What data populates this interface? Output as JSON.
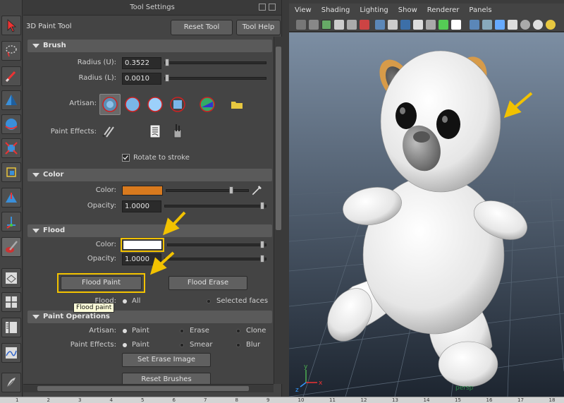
{
  "panel": {
    "title": "Tool Settings",
    "tool_name": "3D Paint Tool",
    "reset_tool": "Reset Tool",
    "tool_help": "Tool Help"
  },
  "brush": {
    "header": "Brush",
    "radius_u_label": "Radius (U):",
    "radius_u": "0.3522",
    "radius_l_label": "Radius (L):",
    "radius_l": "0.0010",
    "artisan_label": "Artisan:",
    "paint_effects_label": "Paint Effects:",
    "rotate_label": "Rotate to stroke"
  },
  "color_section": {
    "header": "Color",
    "color_label": "Color:",
    "color_value": "#d97a1e",
    "opacity_label": "Opacity:",
    "opacity": "1.0000"
  },
  "flood": {
    "header": "Flood",
    "color_label": "Color:",
    "color_value": "#ffffff",
    "opacity_label": "Opacity:",
    "opacity": "1.0000",
    "flood_paint": "Flood Paint",
    "flood_erase": "Flood Erase",
    "flood_label": "Flood:",
    "all": "All",
    "selected_faces": "Selected faces",
    "tooltip": "Flood paint"
  },
  "paint_ops": {
    "header": "Paint Operations",
    "artisan_label": "Artisan:",
    "paint": "Paint",
    "erase": "Erase",
    "clone": "Clone",
    "pe_label": "Paint Effects:",
    "pe_paint": "Paint",
    "smear": "Smear",
    "blur": "Blur",
    "set_erase": "Set Erase Image",
    "reset_brushes": "Reset Brushes"
  },
  "viewport": {
    "menu": [
      "View",
      "Shading",
      "Lighting",
      "Show",
      "Renderer",
      "Panels"
    ],
    "camera": "persp",
    "axis_x": "x",
    "axis_y": "y",
    "axis_z": "z"
  },
  "timeline": {
    "ticks": [
      "1",
      "2",
      "3",
      "4",
      "5",
      "6",
      "7",
      "8",
      "9",
      "10",
      "11",
      "12",
      "13",
      "14",
      "15",
      "16",
      "17",
      "18"
    ]
  },
  "colors": {
    "highlight": "#f2c200",
    "panel_bg": "#444444"
  }
}
